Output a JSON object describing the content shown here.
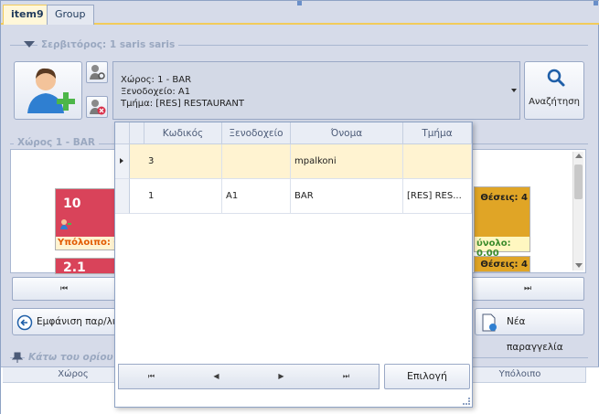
{
  "tabs": [
    {
      "label": "item9"
    },
    {
      "label": "Group"
    }
  ],
  "server_group": {
    "title": "Σερβιτόρος: 1   saris saris"
  },
  "location_combo": {
    "line1": "Χώρος: 1 - BAR",
    "line2": "Ξενοδοχείο: A1",
    "line3": "Τμήμα: [RES] RESTAURANT"
  },
  "search_button": {
    "label": "Αναζήτηση"
  },
  "area_group": {
    "title": "Χώρος 1 - BAR"
  },
  "tables": [
    {
      "number": "10",
      "balance_label": "Υπόλοιπο: 0",
      "color": "#d9435a"
    },
    {
      "number": "2.1",
      "color": "#d9435a"
    }
  ],
  "right_cards": [
    {
      "seats": "Θέσεις: 4",
      "total": "ύνολο: 0,00",
      "color": "#e0a526"
    },
    {
      "seats": "Θέσεις: 4",
      "color": "#e0a526"
    }
  ],
  "buttons": {
    "show_orders": "Εμφάνιση παρ/λιώ",
    "new_order": "Νέα παραγγελία"
  },
  "below_limit_group": {
    "title": "Κάτω του ορίου"
  },
  "bottom_grid": {
    "columns": [
      "Χώρος",
      "Υπόλοιπο"
    ]
  },
  "popup": {
    "columns": [
      "Κωδικός",
      "Ξενοδοχείο",
      "Όνομα",
      "Τμήμα"
    ],
    "rows": [
      [
        "3",
        "",
        "mpalkoni",
        ""
      ],
      [
        "1",
        "A1",
        "BAR",
        "[RES] RES..."
      ]
    ],
    "select_button": "Επιλογή"
  }
}
